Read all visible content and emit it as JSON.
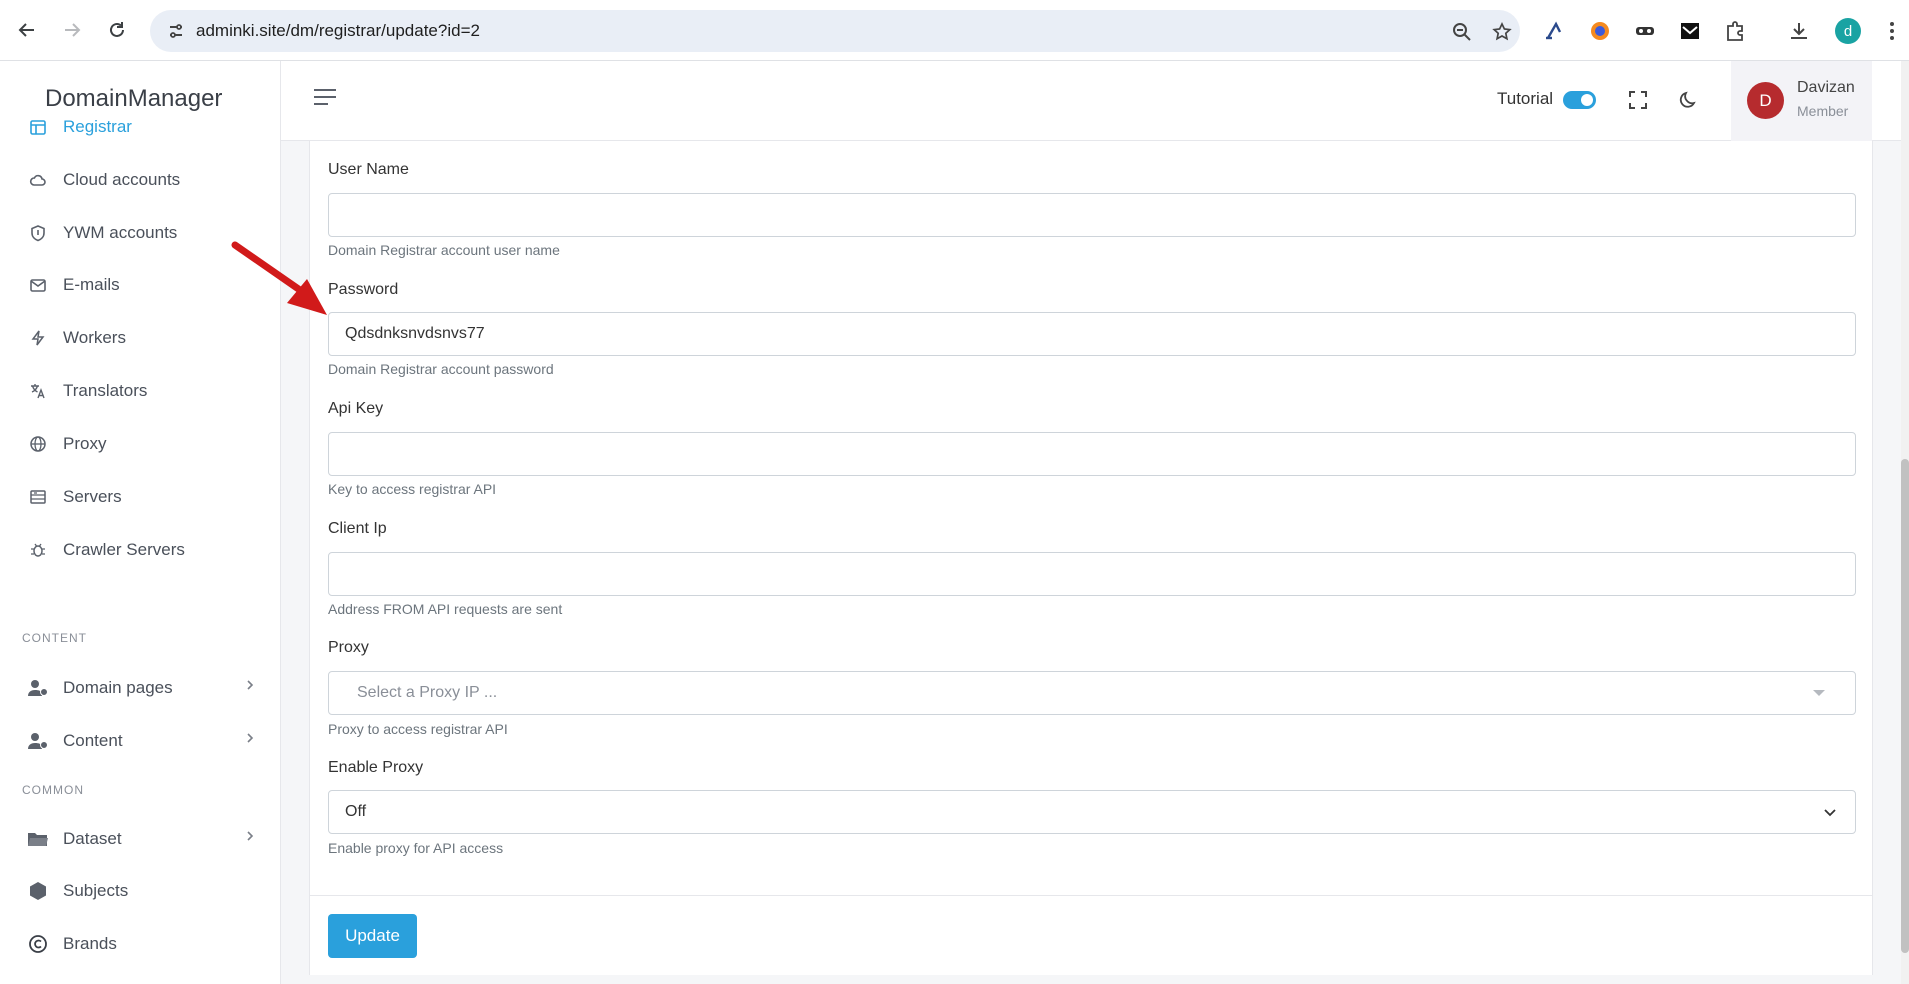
{
  "browser": {
    "url": "adminki.site/dm/registrar/update?id=2",
    "profile_initial": "d"
  },
  "sidebar": {
    "brand": "DomainManager",
    "items": [
      {
        "label": "Registrar",
        "icon": "calendar-icon",
        "active": true
      },
      {
        "label": "Cloud accounts",
        "icon": "cloud-icon"
      },
      {
        "label": "YWM accounts",
        "icon": "shield-icon"
      },
      {
        "label": "E-mails",
        "icon": "mail-icon"
      },
      {
        "label": "Workers",
        "icon": "lightning-icon"
      },
      {
        "label": "Translators",
        "icon": "translate-icon"
      },
      {
        "label": "Proxy",
        "icon": "globe-icon"
      },
      {
        "label": "Servers",
        "icon": "server-icon"
      },
      {
        "label": "Crawler Servers",
        "icon": "bug-icon"
      }
    ],
    "section_content": "CONTENT",
    "content_items": [
      {
        "label": "Domain pages",
        "icon": "users-icon"
      },
      {
        "label": "Content",
        "icon": "users-icon"
      }
    ],
    "section_common": "COMMON",
    "common_items": [
      {
        "label": "Dataset",
        "icon": "folder-icon"
      },
      {
        "label": "Subjects",
        "icon": "hexagon-icon"
      },
      {
        "label": "Brands",
        "icon": "copyright-icon"
      }
    ]
  },
  "header": {
    "tutorial_label": "Tutorial",
    "tutorial_on": true,
    "user_initial": "D",
    "user_name": "Davizan",
    "user_role": "Member"
  },
  "form": {
    "username": {
      "label": "User Name",
      "value": "",
      "help": "Domain Registrar account user name"
    },
    "password": {
      "label": "Password",
      "value": "Qdsdnksnvdsnvs77",
      "help": "Domain Registrar account password"
    },
    "api_key": {
      "label": "Api Key",
      "value": "",
      "help": "Key to access registrar API"
    },
    "client_ip": {
      "label": "Client Ip",
      "value": "",
      "help": "Address FROM API requests are sent"
    },
    "proxy": {
      "label": "Proxy",
      "placeholder": "Select a Proxy IP ...",
      "help": "Proxy to access registrar API"
    },
    "enable_proxy": {
      "label": "Enable Proxy",
      "value": "Off",
      "help": "Enable proxy for API access"
    },
    "submit_label": "Update"
  },
  "colors": {
    "accent": "#2aa0dc",
    "avatar": "#b62b2e",
    "annotation_arrow": "#d11a1a"
  }
}
